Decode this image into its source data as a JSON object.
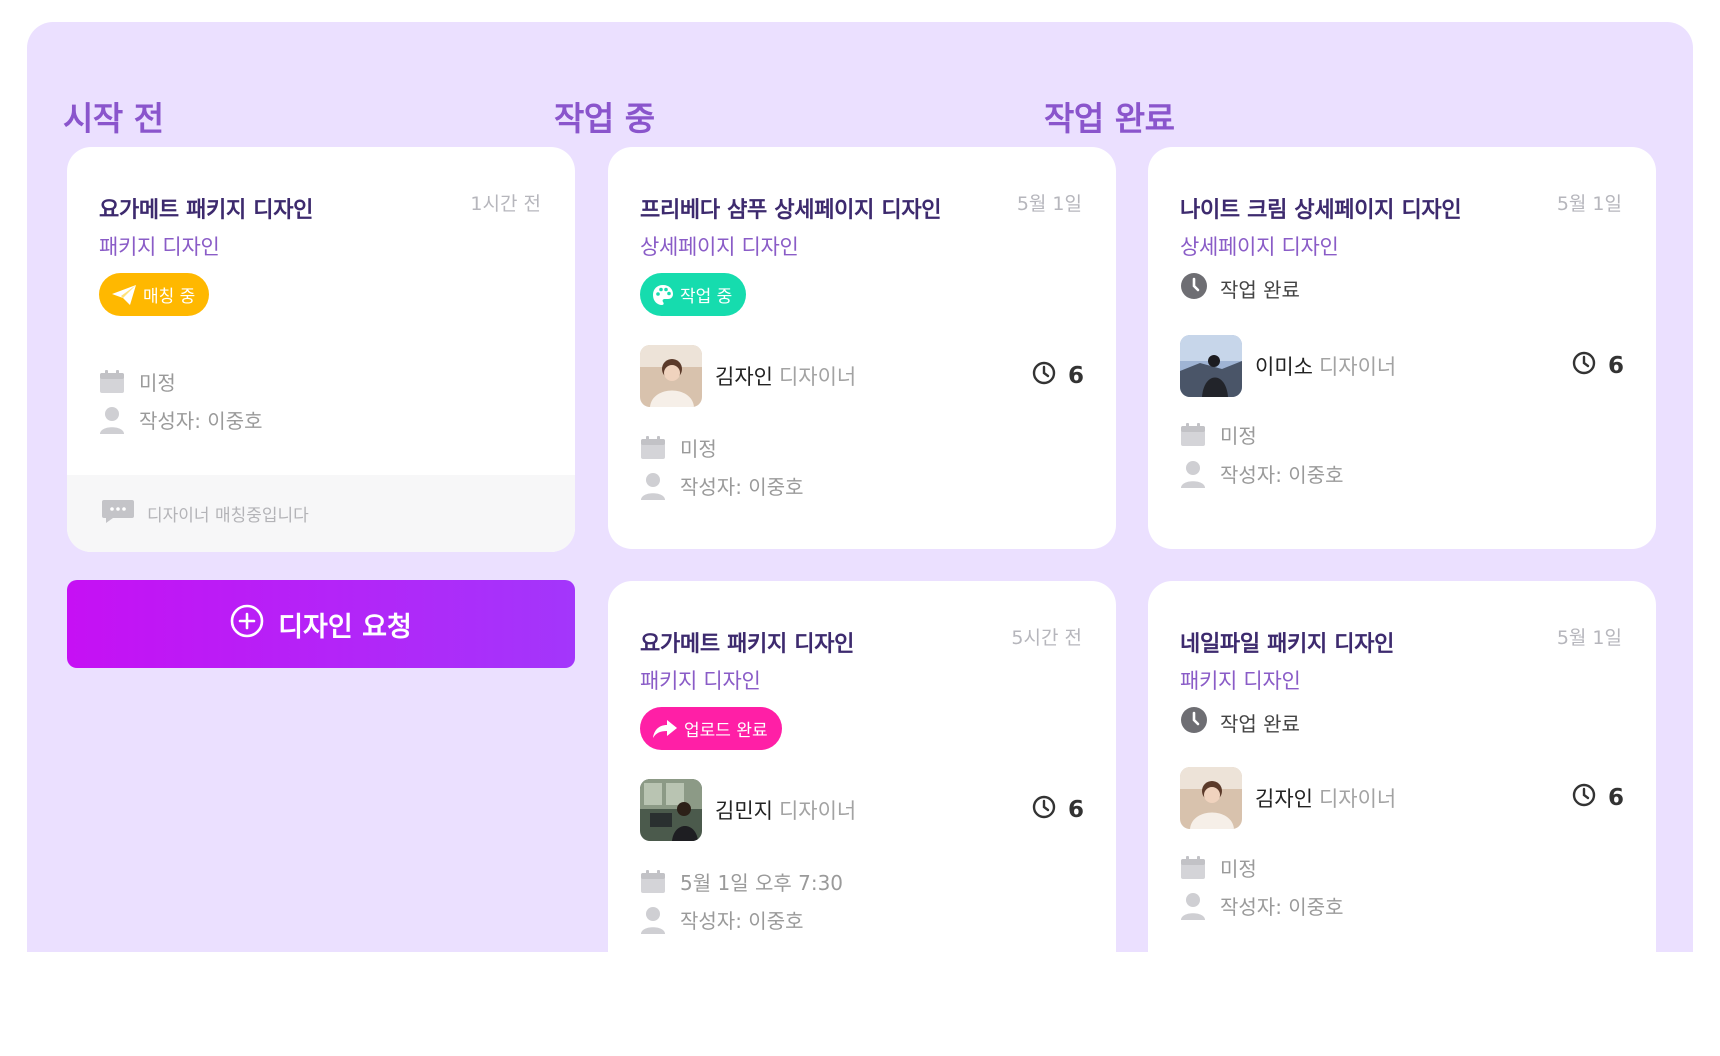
{
  "columns": {
    "todo": {
      "title": "시작 전"
    },
    "doing": {
      "title": "작업 중"
    },
    "done": {
      "title": "작업 완료"
    }
  },
  "cards": {
    "c1": {
      "title": "요가메트 패키지 디자인",
      "time": "1시간 전",
      "category": "패키지 디자인",
      "status": "매칭 중",
      "status_color": "#ffb800",
      "date": "미정",
      "author": "작성자: 이중호",
      "footer": "디자이너 매칭중입니다"
    },
    "c2": {
      "title": "프리베다 샴푸 상세페이지 디자인",
      "time": "5월 1일",
      "category": "상세페이지 디자인",
      "status": "작업 중",
      "status_color": "#16dcae",
      "designer_name": "김자인",
      "designer_role": "디자이너",
      "count": "6",
      "date": "미정",
      "author": "작성자: 이중호"
    },
    "c3": {
      "title": "요가메트 패키지 디자인",
      "time": "5시간 전",
      "category": "패키지 디자인",
      "status": "업로드 완료",
      "status_color": "#ff1fa6",
      "designer_name": "김민지",
      "designer_role": "디자이너",
      "count": "6",
      "date": "5월 1일 오후 7:30",
      "author": "작성자: 이중호"
    },
    "c4": {
      "title": "나이트 크림 상세페이지 디자인",
      "time": "5월 1일",
      "category": "상세페이지 디자인",
      "status": "작업 완료",
      "designer_name": "이미소",
      "designer_role": "디자이너",
      "count": "6",
      "date": "미정",
      "author": "작성자: 이중호"
    },
    "c5": {
      "title": "네일파일 패키지 디자인",
      "time": "5월 1일",
      "category": "패키지 디자인",
      "status": "작업 완료",
      "designer_name": "김자인",
      "designer_role": "디자이너",
      "count": "6",
      "date": "미정",
      "author": "작성자: 이중호"
    }
  },
  "request_button": {
    "label": "디자인 요청"
  },
  "colors": {
    "board_bg": "#ebe0ff",
    "column_title": "#8a55cc",
    "button_start": "#c610f4",
    "button_end": "#a336fb"
  }
}
